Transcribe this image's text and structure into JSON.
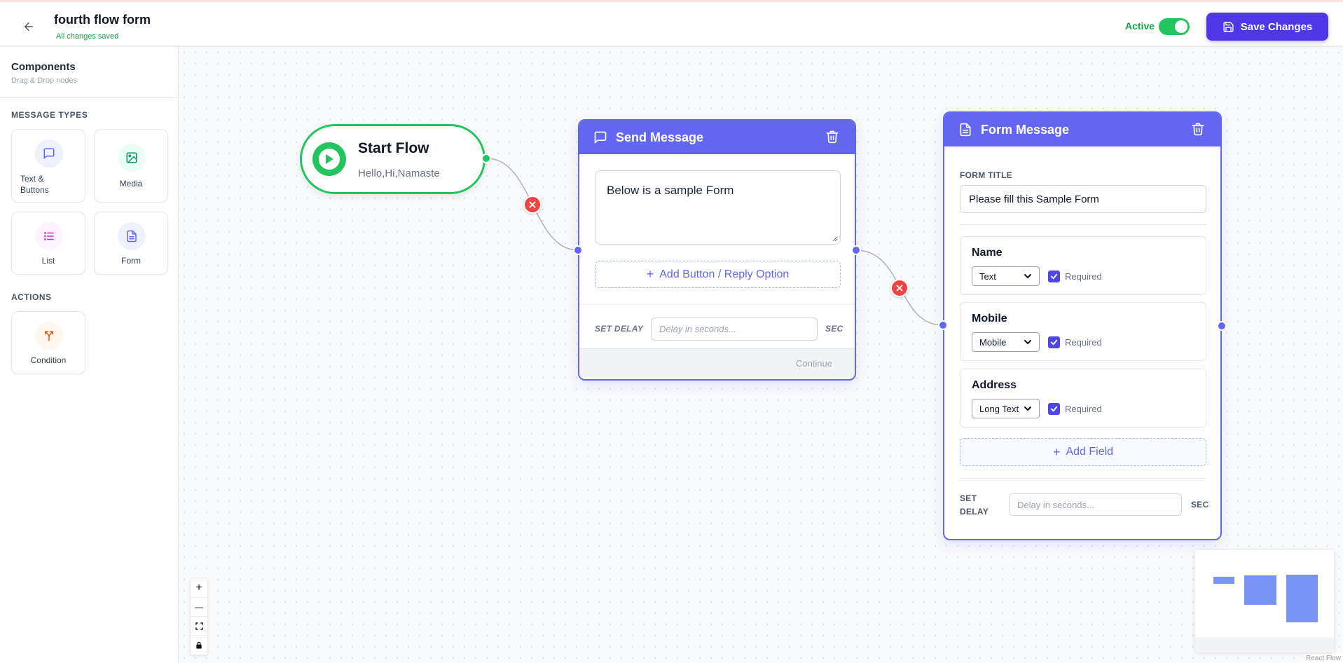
{
  "header": {
    "flow_name": "fourth flow form",
    "save_status": "All changes saved",
    "active_label": "Active",
    "active": true,
    "save_button": "Save Changes"
  },
  "sidebar": {
    "title": "Components",
    "subtitle": "Drag & Drop nodes",
    "message_types_label": "MESSAGE TYPES",
    "actions_label": "ACTIONS",
    "components": [
      {
        "label_line1": "Text &",
        "label_line2": "Buttons",
        "icon": "chat-icon"
      },
      {
        "label": "Media",
        "icon": "image-icon"
      },
      {
        "label": "List",
        "icon": "list-icon"
      },
      {
        "label": "Form",
        "icon": "document-icon"
      }
    ],
    "actions": [
      {
        "label": "Condition",
        "icon": "branch-icon"
      }
    ]
  },
  "start_node": {
    "title": "Start Flow",
    "subtitle": "Hello,Hi,Namaste"
  },
  "send_message_node": {
    "title": "Send Message",
    "message": "Below is a sample Form",
    "add_button_label": "Add Button / Reply Option",
    "delay_label": "SET DELAY",
    "delay_placeholder": "Delay in seconds...",
    "delay_unit": "SEC",
    "continue_label": "Continue"
  },
  "form_node": {
    "title": "Form Message",
    "form_title_label": "FORM TITLE",
    "form_title_value": "Please fill this Sample Form",
    "fields": [
      {
        "name": "Name",
        "type": "Text",
        "required_label": "Required",
        "required": true
      },
      {
        "name": "Mobile",
        "type": "Mobile",
        "required_label": "Required",
        "required": true
      },
      {
        "name": "Address",
        "type": "Long Text",
        "required_label": "Required",
        "required": true
      }
    ],
    "add_field_label": "Add Field",
    "delay_label_line1": "SET",
    "delay_label_line2": "DELAY",
    "delay_placeholder": "Delay in seconds...",
    "delay_unit": "SEC"
  },
  "zoom_controls": [
    "+",
    "—"
  ],
  "attribution": "React Flow",
  "colors": {
    "accent": "#4f37e8",
    "node_header": "#6366f1",
    "success": "#22c55e",
    "danger": "#ef4444"
  }
}
